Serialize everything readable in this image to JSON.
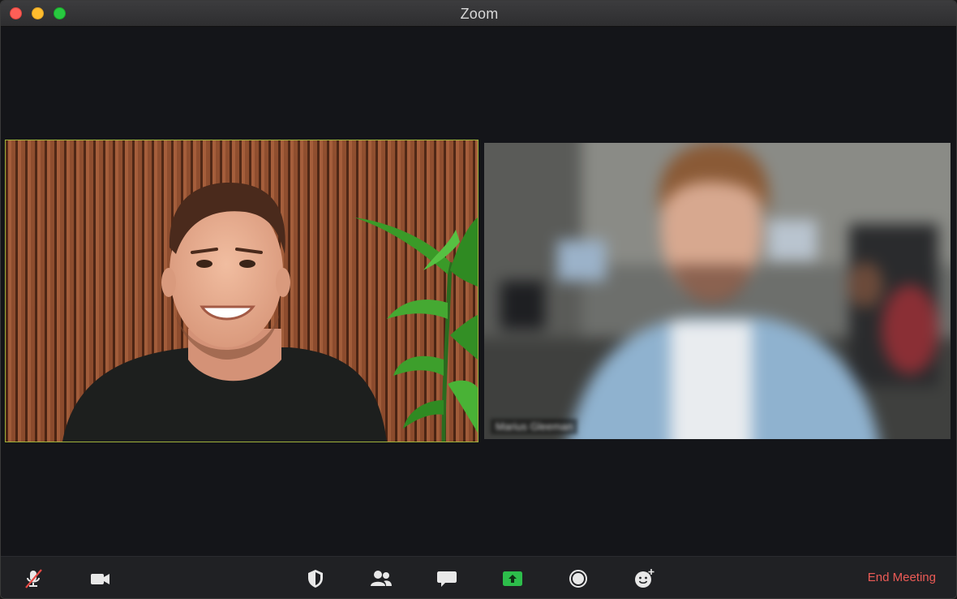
{
  "window": {
    "title": "Zoom"
  },
  "participants": [
    {
      "name": "",
      "state": "active-speaker",
      "highlight_color": "#9fb13b"
    },
    {
      "name": "Marius Gleeman",
      "state": "blurred"
    }
  ],
  "toolbar": {
    "buttons": [
      {
        "icon": "microphone-muted-icon"
      },
      {
        "icon": "video-camera-icon"
      },
      {
        "icon": "security-shield-icon"
      },
      {
        "icon": "participants-icon"
      },
      {
        "icon": "chat-icon"
      },
      {
        "icon": "share-screen-icon",
        "accent": "#2dbe4b"
      },
      {
        "icon": "record-icon"
      },
      {
        "icon": "reactions-icon"
      }
    ],
    "end_meeting_label": "End Meeting"
  },
  "colors": {
    "end_meeting": "#ec5b56",
    "share_green": "#2dbe4b",
    "background": "#141519"
  }
}
